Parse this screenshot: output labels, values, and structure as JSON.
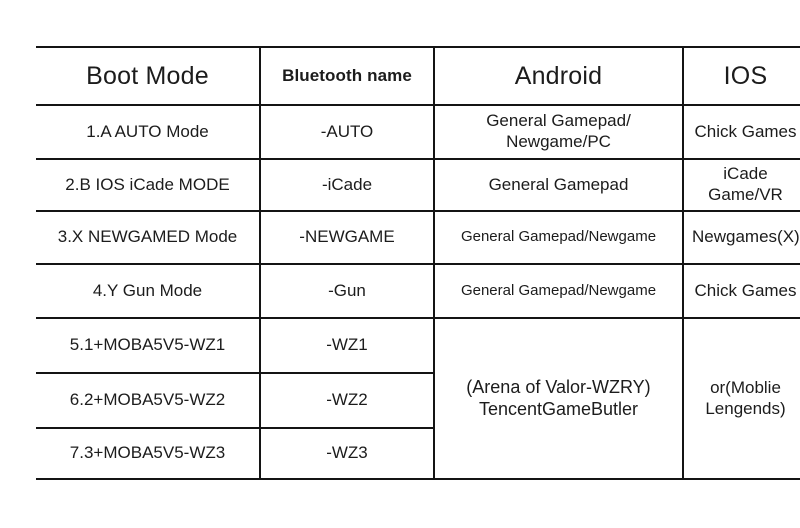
{
  "table": {
    "columns": [
      {
        "key": "boot_mode",
        "label": "Boot Mode"
      },
      {
        "key": "bluetooth_name",
        "label": "Bluetooth name"
      },
      {
        "key": "android",
        "label": "Android"
      },
      {
        "key": "ios",
        "label": "IOS"
      }
    ],
    "rows": [
      {
        "boot_mode": "1.A AUTO Mode",
        "bluetooth_name": "-AUTO",
        "android": "General Gamepad/\nNewgame/PC",
        "ios": "Chick Games"
      },
      {
        "boot_mode": "2.B IOS iCade MODE",
        "bluetooth_name": "-iCade",
        "android": "General Gamepad",
        "ios": "iCade Game/VR"
      },
      {
        "boot_mode": "3.X NEWGAMED Mode",
        "bluetooth_name": "-NEWGAME",
        "android": "General Gamepad/Newgame",
        "ios": "Newgames(X)"
      },
      {
        "boot_mode": "4.Y Gun Mode",
        "bluetooth_name": "-Gun",
        "android": "General Gamepad/Newgame",
        "ios": "Chick Games"
      },
      {
        "boot_mode": "5.1+MOBA5V5-WZ1",
        "bluetooth_name": "-WZ1"
      },
      {
        "boot_mode": "6.2+MOBA5V5-WZ2",
        "bluetooth_name": "-WZ2"
      },
      {
        "boot_mode": "7.3+MOBA5V5-WZ3",
        "bluetooth_name": "-WZ3"
      }
    ],
    "merged": {
      "android_moba": "(Arena of Valor-WZRY)\nTencentGameButler",
      "ios_moba": "or(Moblie Lengends)"
    }
  },
  "colors": {
    "background": "#ffffff",
    "border": "#141414",
    "text": "#1c1c1c"
  }
}
